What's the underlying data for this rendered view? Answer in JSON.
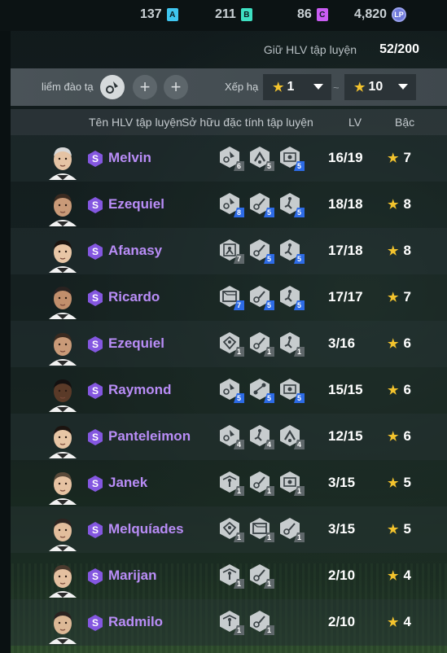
{
  "currency": [
    {
      "value": "137",
      "badge": "A",
      "color": "#3fc6f0"
    },
    {
      "value": "211",
      "badge": "B",
      "color": "#3ee0c2"
    },
    {
      "value": "86",
      "badge": "C",
      "color": "#c95cf2"
    },
    {
      "value": "4,820",
      "badge": "LP",
      "color": "#6f79d9"
    }
  ],
  "header": {
    "label": "Giữ HLV tập luyện",
    "count": "52/200"
  },
  "filter": {
    "training_label": "liểm đào tạ",
    "rank_label": "Xếp hạ",
    "rank_from": "1",
    "tilde": "~",
    "rank_to": "10",
    "plus": "+"
  },
  "columns": {
    "name": "Tên HLV tập luyện",
    "traits": "Sở hữu đặc tính tập luyện",
    "lv": "LV",
    "rank": "Bậc"
  },
  "coaches": [
    {
      "name": "Melvin",
      "lv": "16/19",
      "rank": "7",
      "traits": [
        {
          "icon": "dribble-icon",
          "level": "6",
          "color": "grey"
        },
        {
          "icon": "tackle-icon",
          "level": "5",
          "color": "grey"
        },
        {
          "icon": "goal-icon",
          "level": "5",
          "color": "blue"
        }
      ]
    },
    {
      "name": "Ezequiel",
      "lv": "18/18",
      "rank": "8",
      "traits": [
        {
          "icon": "dribble-icon",
          "level": "8",
          "color": "blue"
        },
        {
          "icon": "shot-icon",
          "level": "5",
          "color": "blue"
        },
        {
          "icon": "runner-icon",
          "level": "5",
          "color": "blue"
        }
      ]
    },
    {
      "name": "Afanasy",
      "lv": "17/18",
      "rank": "8",
      "traits": [
        {
          "icon": "keeper-icon",
          "level": "7",
          "color": "grey"
        },
        {
          "icon": "shot-icon",
          "level": "5",
          "color": "blue"
        },
        {
          "icon": "runner-icon",
          "level": "5",
          "color": "blue"
        }
      ]
    },
    {
      "name": "Ricardo",
      "lv": "17/17",
      "rank": "7",
      "traits": [
        {
          "icon": "net-icon",
          "level": "7",
          "color": "blue"
        },
        {
          "icon": "shot-icon",
          "level": "5",
          "color": "blue"
        },
        {
          "icon": "runner-icon",
          "level": "5",
          "color": "blue"
        }
      ]
    },
    {
      "name": "Ezequiel",
      "lv": "3/16",
      "rank": "6",
      "traits": [
        {
          "icon": "header-icon",
          "level": "1",
          "color": "grey"
        },
        {
          "icon": "shot-icon",
          "level": "1",
          "color": "grey"
        },
        {
          "icon": "runner-icon",
          "level": "1",
          "color": "grey"
        }
      ]
    },
    {
      "name": "Raymond",
      "lv": "15/15",
      "rank": "6",
      "traits": [
        {
          "icon": "dribble-icon",
          "level": "5",
          "color": "blue"
        },
        {
          "icon": "pass-icon",
          "level": "5",
          "color": "blue"
        },
        {
          "icon": "goal-icon",
          "level": "5",
          "color": "blue"
        }
      ]
    },
    {
      "name": "Panteleimon",
      "lv": "12/15",
      "rank": "6",
      "traits": [
        {
          "icon": "dribble-icon",
          "level": "4",
          "color": "grey"
        },
        {
          "icon": "runner-icon",
          "level": "4",
          "color": "grey"
        },
        {
          "icon": "tackle-icon",
          "level": "4",
          "color": "grey"
        }
      ]
    },
    {
      "name": "Janek",
      "lv": "3/15",
      "rank": "5",
      "traits": [
        {
          "icon": "jump-icon",
          "level": "1",
          "color": "grey"
        },
        {
          "icon": "shot-icon",
          "level": "1",
          "color": "grey"
        },
        {
          "icon": "goal-icon",
          "level": "1",
          "color": "grey"
        }
      ]
    },
    {
      "name": "Melquíades",
      "lv": "3/15",
      "rank": "5",
      "traits": [
        {
          "icon": "header-icon",
          "level": "1",
          "color": "grey"
        },
        {
          "icon": "net-icon",
          "level": "1",
          "color": "grey"
        },
        {
          "icon": "shot-icon",
          "level": "1",
          "color": "grey"
        }
      ]
    },
    {
      "name": "Marijan",
      "lv": "2/10",
      "rank": "4",
      "traits": [
        {
          "icon": "jump-icon",
          "level": "1",
          "color": "grey"
        },
        {
          "icon": "shot-icon",
          "level": "1",
          "color": "grey"
        }
      ]
    },
    {
      "name": "Radmilo",
      "lv": "2/10",
      "rank": "4",
      "traits": [
        {
          "icon": "jump-icon",
          "level": "1",
          "color": "grey"
        },
        {
          "icon": "shot-icon",
          "level": "1",
          "color": "grey"
        }
      ]
    }
  ]
}
